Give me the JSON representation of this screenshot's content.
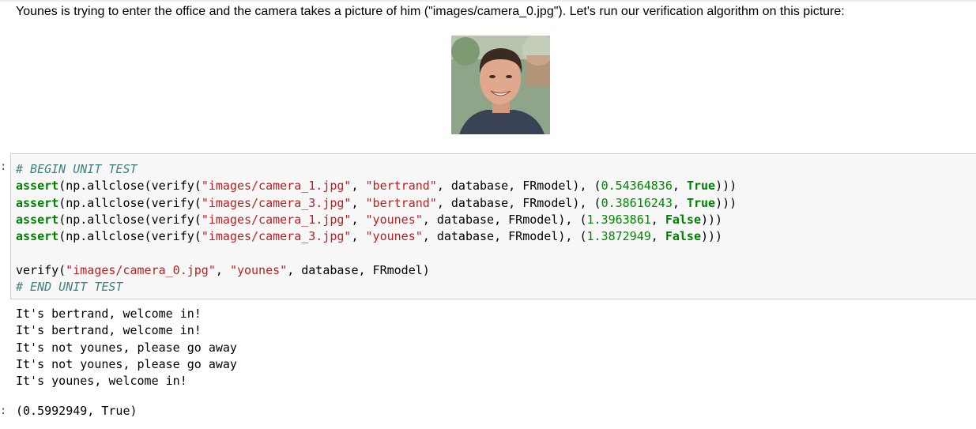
{
  "markdown": {
    "text": "Younes is trying to enter the office and the camera takes a picture of him (\"images/camera_0.jpg\"). Let's run our verification algorithm on this picture:"
  },
  "image": {
    "alt": "camera_0 photo"
  },
  "cell": {
    "prompt_marker": ":",
    "comment_begin": "# BEGIN UNIT TEST",
    "assert_kw": "assert",
    "np_call": "(np.allclose(verify(",
    "database_args": ", database, FRmodel), (",
    "lines": [
      {
        "path": "\"images/camera_1.jpg\"",
        "name": "\"bertrand\"",
        "num": "0.54364836",
        "bool": "True"
      },
      {
        "path": "\"images/camera_3.jpg\"",
        "name": "\"bertrand\"",
        "num": "0.38616243",
        "bool": "True"
      },
      {
        "path": "\"images/camera_1.jpg\"",
        "name": "\"younes\"",
        "num": "1.3963861",
        "bool": "False"
      },
      {
        "path": "\"images/camera_3.jpg\"",
        "name": "\"younes\"",
        "num": "1.3872949",
        "bool": "False"
      }
    ],
    "verify_fn": "verify(",
    "verify_path": "\"images/camera_0.jpg\"",
    "verify_name": "\"younes\"",
    "verify_tail": ", database, FRmodel)",
    "comment_end": "# END UNIT TEST"
  },
  "output": {
    "lines": [
      "It's bertrand, welcome in!",
      "It's bertrand, welcome in!",
      "It's not younes, please go away",
      "It's not younes, please go away",
      "It's younes, welcome in!"
    ]
  },
  "result": {
    "prompt_marker": ":",
    "value": "(0.5992949, True)"
  }
}
